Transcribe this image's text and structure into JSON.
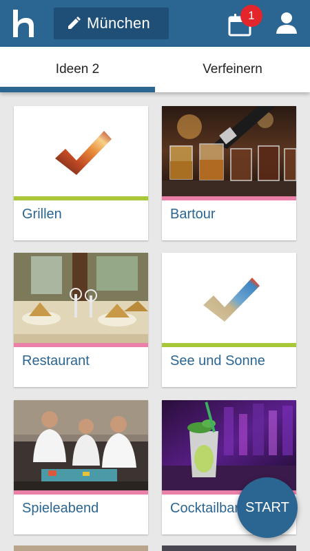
{
  "header": {
    "city_label": "München",
    "notification_count": "1"
  },
  "tabs": [
    {
      "label": "Ideen 2",
      "active": true
    },
    {
      "label": "Verfeinern",
      "active": false
    }
  ],
  "cards": [
    {
      "label": "Grillen",
      "accent": "#a8c83a"
    },
    {
      "label": "Bartour",
      "accent": "#ea7fa7"
    },
    {
      "label": "Restaurant",
      "accent": "#ea7fa7"
    },
    {
      "label": "See und Sonne",
      "accent": "#a8c83a"
    },
    {
      "label": "Spieleabend",
      "accent": "#ea7fa7"
    },
    {
      "label": "Cocktailbar",
      "accent": "#ea7fa7"
    }
  ],
  "fab": {
    "label": "START"
  },
  "colors": {
    "brand": "#2b6592",
    "badge": "#e3252c"
  },
  "icons": [
    "logo-h-icon",
    "pencil-icon",
    "calendar-icon",
    "user-icon",
    "checkmark-icon"
  ]
}
